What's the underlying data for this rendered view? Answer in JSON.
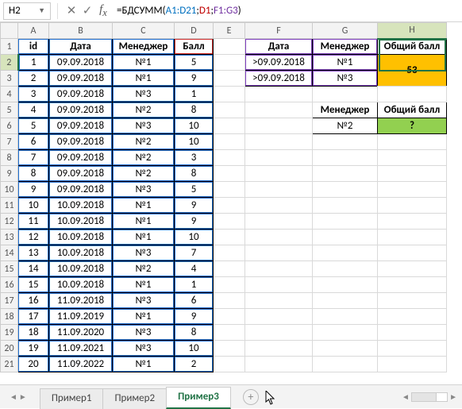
{
  "formula_bar": {
    "cell_ref": "H2",
    "formula_prefix": "=БДСУММ(",
    "arg1": "A1:D21",
    "arg2": "D1",
    "arg3": "F1:G3",
    "formula_suffix": ")"
  },
  "columns": [
    "A",
    "B",
    "C",
    "D",
    "E",
    "F",
    "G",
    "H"
  ],
  "headers_main": {
    "id": "id",
    "date": "Дата",
    "manager": "Менеджер",
    "score": "Балл"
  },
  "main_rows": [
    {
      "id": "1",
      "date": "09.09.2018",
      "mgr": "№1",
      "score": "5"
    },
    {
      "id": "2",
      "date": "09.09.2018",
      "mgr": "№1",
      "score": "9"
    },
    {
      "id": "3",
      "date": "09.09.2018",
      "mgr": "№3",
      "score": "1"
    },
    {
      "id": "4",
      "date": "09.09.2018",
      "mgr": "№2",
      "score": "8"
    },
    {
      "id": "5",
      "date": "09.09.2018",
      "mgr": "№3",
      "score": "10"
    },
    {
      "id": "6",
      "date": "09.09.2018",
      "mgr": "№2",
      "score": "10"
    },
    {
      "id": "7",
      "date": "09.09.2018",
      "mgr": "№2",
      "score": "3"
    },
    {
      "id": "8",
      "date": "09.09.2018",
      "mgr": "№2",
      "score": "8"
    },
    {
      "id": "9",
      "date": "09.09.2018",
      "mgr": "№3",
      "score": "5"
    },
    {
      "id": "10",
      "date": "10.09.2018",
      "mgr": "№1",
      "score": "9"
    },
    {
      "id": "11",
      "date": "10.09.2018",
      "mgr": "№1",
      "score": "9"
    },
    {
      "id": "12",
      "date": "10.09.2018",
      "mgr": "№1",
      "score": "10"
    },
    {
      "id": "13",
      "date": "10.09.2018",
      "mgr": "№3",
      "score": "7"
    },
    {
      "id": "14",
      "date": "10.09.2018",
      "mgr": "№2",
      "score": "4"
    },
    {
      "id": "15",
      "date": "10.09.2018",
      "mgr": "№1",
      "score": "1"
    },
    {
      "id": "16",
      "date": "11.09.2018",
      "mgr": "№3",
      "score": "6"
    },
    {
      "id": "17",
      "date": "11.09.2019",
      "mgr": "№1",
      "score": "9"
    },
    {
      "id": "18",
      "date": "11.09.2020",
      "mgr": "№3",
      "score": "8"
    },
    {
      "id": "19",
      "date": "11.09.2021",
      "mgr": "№3",
      "score": "10"
    },
    {
      "id": "20",
      "date": "11.09.2022",
      "mgr": "№1",
      "score": "2"
    }
  ],
  "criteria1": {
    "h_date": "Дата",
    "h_mgr": "Менеджер",
    "h_total": "Общий балл",
    "r1_date": ">09.09.2018",
    "r1_mgr": "№1",
    "r2_date": ">09.09.2018",
    "r2_mgr": "№3",
    "result": "53"
  },
  "criteria2": {
    "h_mgr": "Менеджер",
    "h_total": "Общий балл",
    "r1_mgr": "№2",
    "result": "?"
  },
  "sheets": {
    "s1": "Пример1",
    "s2": "Пример2",
    "s3": "Пример3"
  }
}
